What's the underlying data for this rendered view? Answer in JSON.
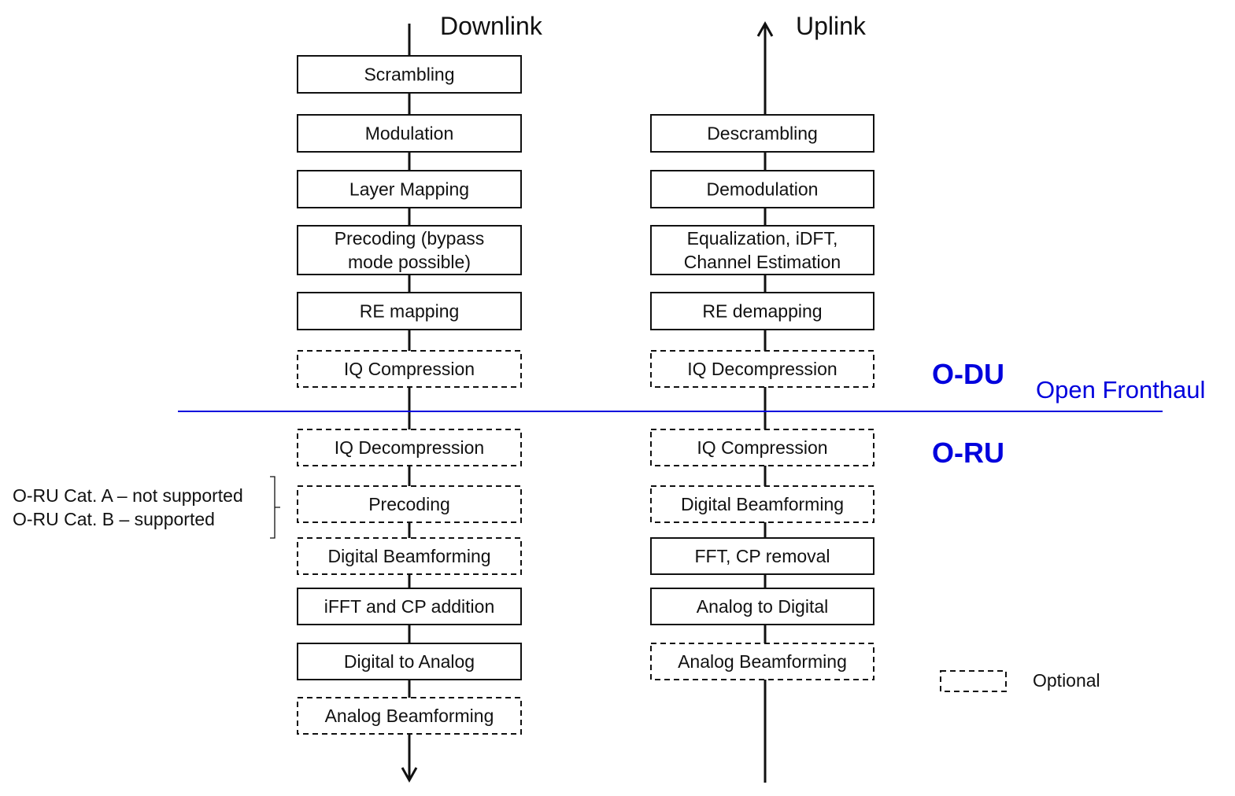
{
  "downlink": {
    "title": "Downlink",
    "blocks": [
      {
        "lines": [
          "Scrambling"
        ],
        "optional": false
      },
      {
        "lines": [
          "Modulation"
        ],
        "optional": false
      },
      {
        "lines": [
          "Layer Mapping"
        ],
        "optional": false
      },
      {
        "lines": [
          "Precoding (bypass",
          "mode possible)"
        ],
        "optional": false
      },
      {
        "lines": [
          "RE mapping"
        ],
        "optional": false
      },
      {
        "lines": [
          "IQ Compression"
        ],
        "optional": true
      },
      {
        "lines": [
          "IQ Decompression"
        ],
        "optional": true
      },
      {
        "lines": [
          "Precoding"
        ],
        "optional": true
      },
      {
        "lines": [
          "Digital Beamforming"
        ],
        "optional": true
      },
      {
        "lines": [
          "iFFT and CP addition"
        ],
        "optional": false
      },
      {
        "lines": [
          "Digital to Analog"
        ],
        "optional": false
      },
      {
        "lines": [
          "Analog Beamforming"
        ],
        "optional": true
      }
    ]
  },
  "uplink": {
    "title": "Uplink",
    "blocks": [
      {
        "lines": [
          "Descrambling"
        ],
        "optional": false
      },
      {
        "lines": [
          "Demodulation"
        ],
        "optional": false
      },
      {
        "lines": [
          "Equalization, iDFT,",
          "Channel Estimation"
        ],
        "optional": false
      },
      {
        "lines": [
          "RE demapping"
        ],
        "optional": false
      },
      {
        "lines": [
          "IQ Decompression"
        ],
        "optional": true
      },
      {
        "lines": [
          "IQ Compression"
        ],
        "optional": true
      },
      {
        "lines": [
          "Digital Beamforming"
        ],
        "optional": true
      },
      {
        "lines": [
          "FFT, CP removal"
        ],
        "optional": false
      },
      {
        "lines": [
          "Analog to Digital"
        ],
        "optional": false
      },
      {
        "lines": [
          "Analog Beamforming"
        ],
        "optional": true
      }
    ]
  },
  "split": {
    "upper_label": "O-DU",
    "lower_label": "O-RU",
    "interface_label": "Open Fronthaul",
    "color": "#0000dd"
  },
  "annotation": {
    "lines": [
      "O-RU Cat. A – not supported",
      "O-RU Cat. B – supported"
    ]
  },
  "legend": {
    "label": "Optional"
  }
}
